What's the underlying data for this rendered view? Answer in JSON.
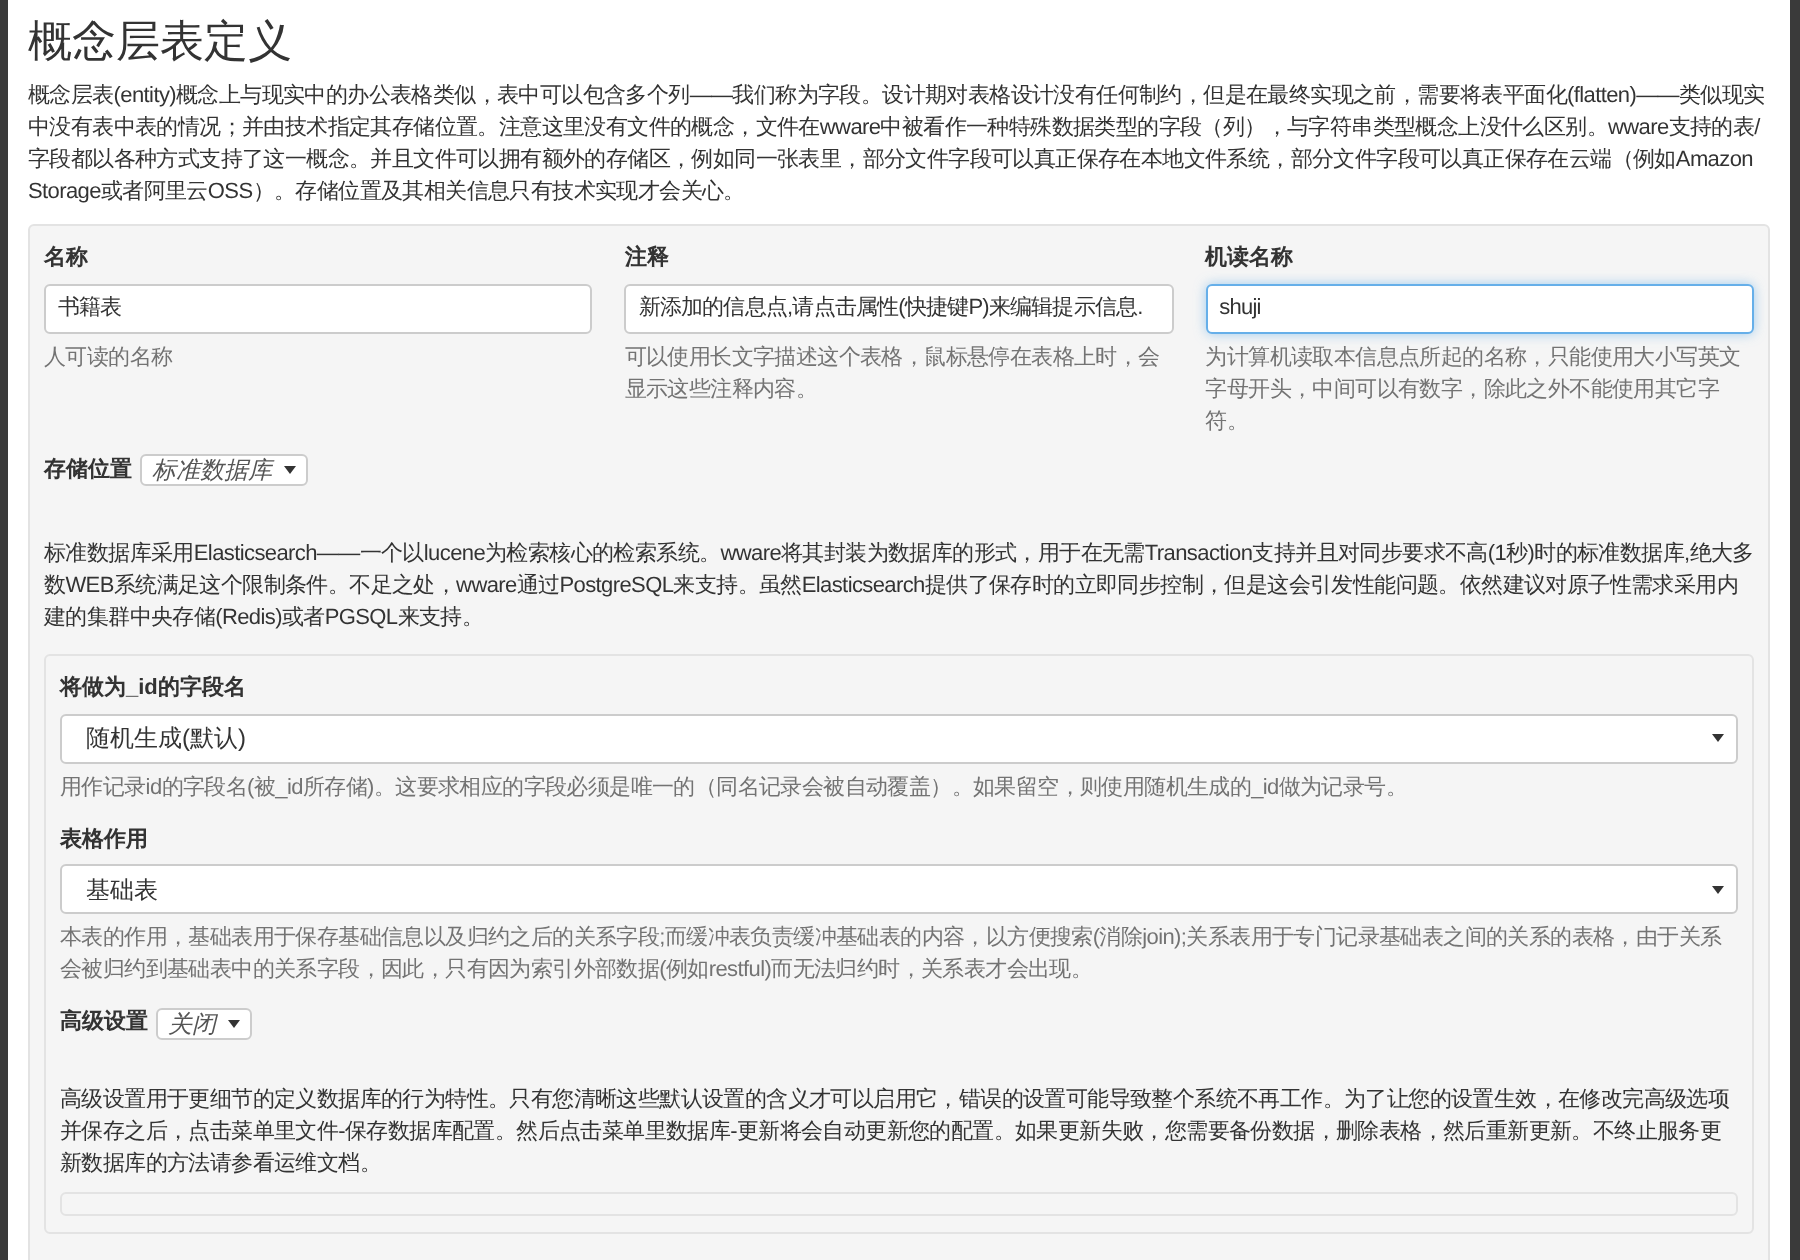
{
  "page_title": "概念层表定义",
  "intro": "概念层表(entity)概念上与现实中的办公表格类似，表中可以包含多个列——我们称为字段。设计期对表格设计没有任何制约，但是在最终实现之前，需要将表平面化(flatten)——类似现实中没有表中表的情况；并由技术指定其存储位置。注意这里没有文件的概念，文件在wware中被看作一种特殊数据类型的字段（列），与字符串类型概念上没什么区别。wware支持的表/字段都以各种方式支持了这一概念。并且文件可以拥有额外的存储区，例如同一张表里，部分文件字段可以真正保存在本地文件系统，部分文件字段可以真正保存在云端（例如Amazon Storage或者阿里云OSS）。存储位置及其相关信息只有技术实现才会关心。",
  "fields": [
    {
      "label": "名称",
      "value": "书籍表",
      "help": "人可读的名称",
      "focused": false
    },
    {
      "label": "注释",
      "value": "新添加的信息点,请点击属性(快捷键P)来编辑提示信息.",
      "help": "可以使用长文字描述这个表格，鼠标悬停在表格上时，会显示这些注释内容。",
      "focused": false
    },
    {
      "label": "机读名称",
      "value": "shuji",
      "help": "为计算机读取本信息点所起的名称，只能使用大小写英文字母开头，中间可以有数字，除此之外不能使用其它字符。",
      "focused": true
    }
  ],
  "storage": {
    "label": "存储位置",
    "value": "标准数据库"
  },
  "storage_description": "标准数据库采用Elasticsearch——一个以lucene为检索核心的检索系统。wware将其封装为数据库的形式，用于在无需Transaction支持并且对同步要求不高(1秒)时的标准数据库,绝大多数WEB系统满足这个限制条件。不足之处，wware通过PostgreSQL来支持。虽然Elasticsearch提供了保存时的立即同步控制，但是这会引发性能问题。依然建议对原子性需求采用内建的集群中央存储(Redis)或者PGSQL来支持。",
  "selects": [
    {
      "label": "将做为_id的字段名",
      "value": "随机生成(默认)",
      "help": "用作记录id的字段名(被_id所存储)。这要求相应的字段必须是唯一的（同名记录会被自动覆盖）。如果留空，则使用随机生成的_id做为记录号。"
    },
    {
      "label": "表格作用",
      "value": "基础表",
      "help": "本表的作用，基础表用于保存基础信息以及归约之后的关系字段;而缓冲表负责缓冲基础表的内容，以方便搜索(消除join);关系表用于专门记录基础表之间的关系的表格，由于关系会被归约到基础表中的关系字段，因此，只有因为索引外部数据(例如restful)而无法归约时，关系表才会出现。"
    }
  ],
  "advanced": {
    "label": "高级设置",
    "value": "关闭"
  },
  "advanced_description": "高级设置用于更细节的定义数据库的行为特性。只有您清晰这些默认设置的含义才可以启用它，错误的设置可能导致整个系统不再工作。为了让您的设置生效，在修改完高级选项并保存之后，点击菜单里文件-保存数据库配置。然后点击菜单里数据库-更新将会自动更新您的配置。如果更新失败，您需要备份数据，删除表格，然后重新更新。不终止服务更新数据库的方法请参看运维文档。"
}
